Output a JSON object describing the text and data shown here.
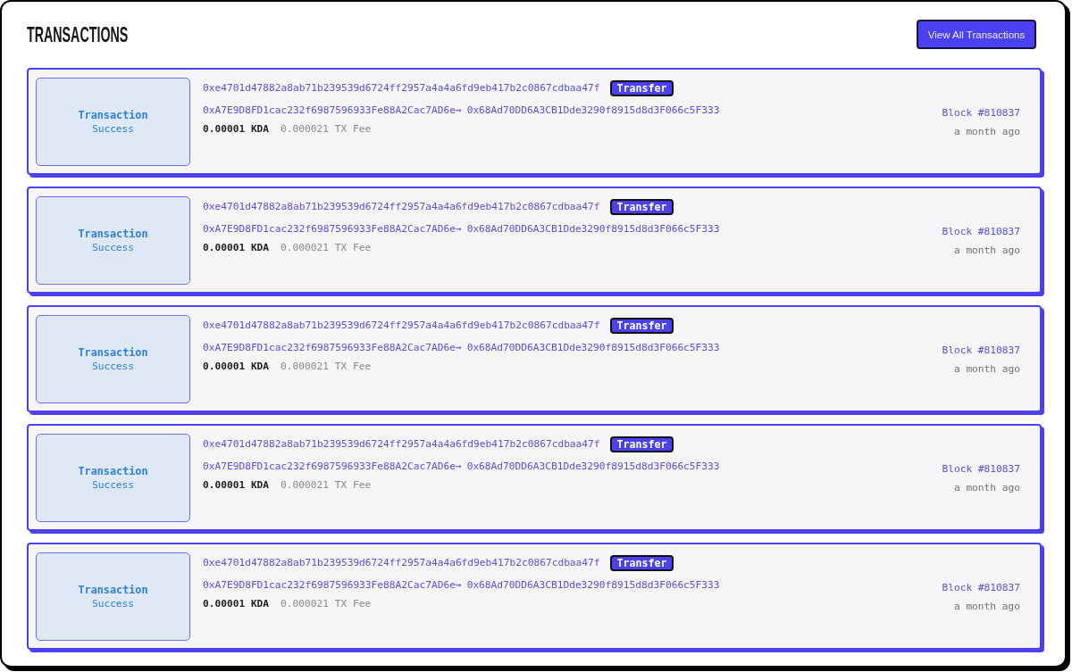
{
  "header": {
    "title": "TRANSACTIONS",
    "button": "View All Transactions"
  },
  "transactions": [
    {
      "status_title": "Transaction",
      "status": "Success",
      "hash": "0xe4701d47882a8ab71b239539d6724ff2957a4a4a6fd9eb417b2c0867cdbaa47f",
      "type": "Transfer",
      "from": "0xA7E9D8FD1cac232f6987596933Fe88A2Cac7AD6e",
      "arrow": "→",
      "to": "0x68Ad70DD6A3CB1Dde3290f8915d8d3F066c5F333",
      "amount": "0.00001 KDA",
      "fee": "0.000021 TX Fee",
      "block": "Block #810837",
      "time": "a month ago"
    },
    {
      "status_title": "Transaction",
      "status": "Success",
      "hash": "0xe4701d47882a8ab71b239539d6724ff2957a4a4a6fd9eb417b2c0867cdbaa47f",
      "type": "Transfer",
      "from": "0xA7E9D8FD1cac232f6987596933Fe88A2Cac7AD6e",
      "arrow": "→",
      "to": "0x68Ad70DD6A3CB1Dde3290f8915d8d3F066c5F333",
      "amount": "0.00001 KDA",
      "fee": "0.000021 TX Fee",
      "block": "Block #810837",
      "time": "a month ago"
    },
    {
      "status_title": "Transaction",
      "status": "Success",
      "hash": "0xe4701d47882a8ab71b239539d6724ff2957a4a4a6fd9eb417b2c0867cdbaa47f",
      "type": "Transfer",
      "from": "0xA7E9D8FD1cac232f6987596933Fe88A2Cac7AD6e",
      "arrow": "→",
      "to": "0x68Ad70DD6A3CB1Dde3290f8915d8d3F066c5F333",
      "amount": "0.00001 KDA",
      "fee": "0.000021 TX Fee",
      "block": "Block #810837",
      "time": "a month ago"
    },
    {
      "status_title": "Transaction",
      "status": "Success",
      "hash": "0xe4701d47882a8ab71b239539d6724ff2957a4a4a6fd9eb417b2c0867cdbaa47f",
      "type": "Transfer",
      "from": "0xA7E9D8FD1cac232f6987596933Fe88A2Cac7AD6e",
      "arrow": "→",
      "to": "0x68Ad70DD6A3CB1Dde3290f8915d8d3F066c5F333",
      "amount": "0.00001 KDA",
      "fee": "0.000021 TX Fee",
      "block": "Block #810837",
      "time": "a month ago"
    },
    {
      "status_title": "Transaction",
      "status": "Success",
      "hash": "0xe4701d47882a8ab71b239539d6724ff2957a4a4a6fd9eb417b2c0867cdbaa47f",
      "type": "Transfer",
      "from": "0xA7E9D8FD1cac232f6987596933Fe88A2Cac7AD6e",
      "arrow": "→",
      "to": "0x68Ad70DD6A3CB1Dde3290f8915d8d3F066c5F333",
      "amount": "0.00001 KDA",
      "fee": "0.000021 TX Fee",
      "block": "Block #810837",
      "time": "a month ago"
    }
  ]
}
